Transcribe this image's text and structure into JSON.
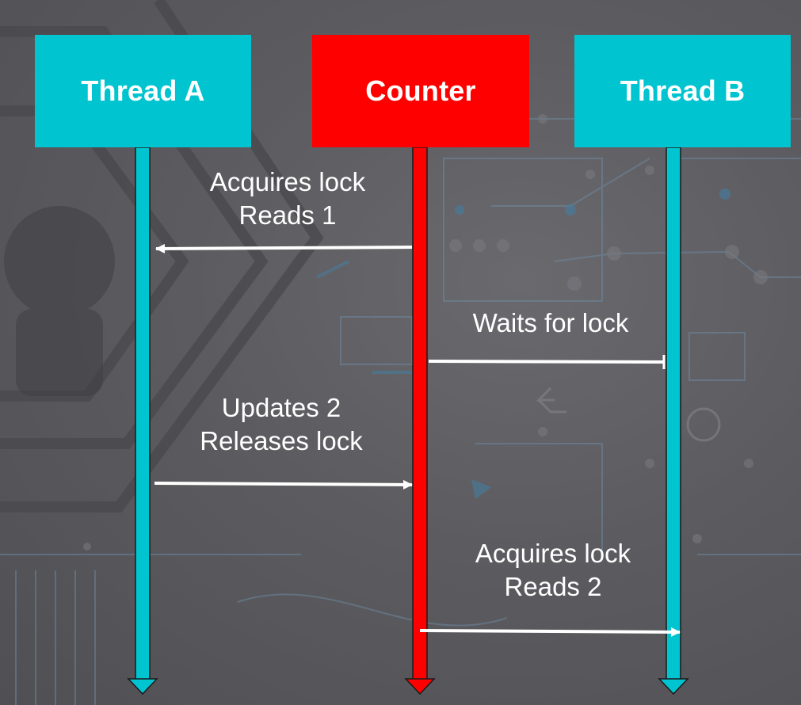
{
  "colors": {
    "thread": "#00c4cf",
    "counter": "#ff0000",
    "arrow": "#ffffff",
    "background": "#5c5c60"
  },
  "headers": {
    "thread_a": "Thread A",
    "counter": "Counter",
    "thread_b": "Thread B"
  },
  "messages": [
    {
      "lines": [
        "Acquires lock",
        "Reads 1"
      ],
      "from": "counter",
      "to": "thread_a"
    },
    {
      "lines": [
        "Waits for lock"
      ],
      "from": "counter",
      "to": "thread_b",
      "style": "blocked"
    },
    {
      "lines": [
        "Updates 2",
        "Releases lock"
      ],
      "from": "thread_a",
      "to": "counter"
    },
    {
      "lines": [
        "Acquires lock",
        "Reads 2"
      ],
      "from": "counter",
      "to": "thread_b"
    }
  ]
}
